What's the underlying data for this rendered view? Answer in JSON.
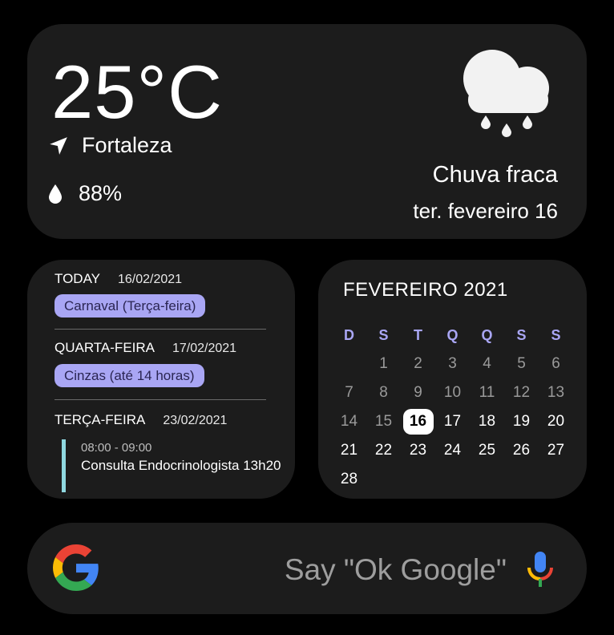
{
  "weather": {
    "temperature": "25°C",
    "location": "Fortaleza",
    "humidity": "88%",
    "condition": "Chuva fraca",
    "date": "ter. fevereiro 16",
    "icon": "cloud-rain-icon"
  },
  "agenda": {
    "sections": [
      {
        "label": "TODAY",
        "date": "16/02/2021",
        "event": "Carnaval (Terça-feira)"
      },
      {
        "label": "QUARTA-FEIRA",
        "date": "17/02/2021",
        "event": "Cinzas (até 14 horas)"
      },
      {
        "label": "TERÇA-FEIRA",
        "date": "23/02/2021",
        "event_time": "08:00 - 09:00",
        "event_title": "Consulta Endocrinologista 13h20"
      }
    ],
    "colors": {
      "pill": "#a9a6f4",
      "event_bar": "#8fd8e0"
    }
  },
  "calendar": {
    "title": "FEVEREIRO 2021",
    "weekdays": [
      "D",
      "S",
      "T",
      "Q",
      "Q",
      "S",
      "S"
    ],
    "lead_blanks": 1,
    "days": [
      "1",
      "2",
      "3",
      "4",
      "5",
      "6",
      "7",
      "8",
      "9",
      "10",
      "11",
      "12",
      "13",
      "14",
      "15",
      "16",
      "17",
      "18",
      "19",
      "20",
      "21",
      "22",
      "23",
      "24",
      "25",
      "26",
      "27",
      "28"
    ],
    "today": "16"
  },
  "search": {
    "hint": "Say \"Ok Google\"",
    "logo_icon": "google-g-icon",
    "mic_icon": "microphone-icon"
  }
}
